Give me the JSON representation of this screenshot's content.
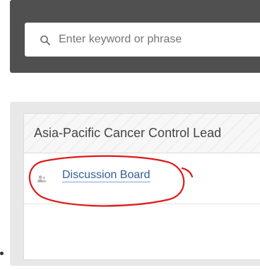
{
  "search": {
    "placeholder": "Enter keyword or phrase",
    "icon": "search-icon"
  },
  "panel": {
    "title": "Asia-Pacific Cancer Control Lead",
    "items": [
      {
        "label": "Discussion Board",
        "icon": "group-icon"
      }
    ]
  },
  "colors": {
    "search_bar": "#505050",
    "link": "#2f5f99",
    "annotation": "#dd1a1a"
  }
}
